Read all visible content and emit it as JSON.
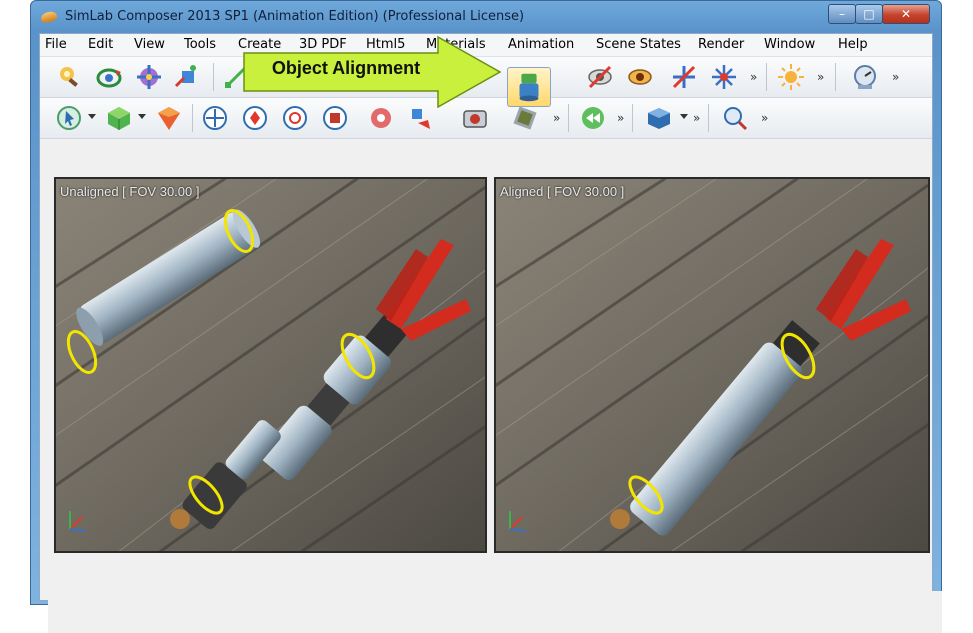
{
  "window": {
    "title": "SimLab Composer 2013 SP1 (Animation Edition)  (Professional License)",
    "controls": {
      "minimize": "–",
      "maximize": "□",
      "close": "✕"
    }
  },
  "menu": [
    "File",
    "Edit",
    "View",
    "Tools",
    "Create",
    "3D PDF",
    "Html5",
    "Materials",
    "Animation",
    "Scene States",
    "Render",
    "Window",
    "Help"
  ],
  "toolbar_overflow": "»",
  "callout": {
    "label": "Object Alignment",
    "color": "#c8f03c"
  },
  "viewports": {
    "left": {
      "label": "Unaligned [ FOV 30.00 ]"
    },
    "right": {
      "label": "Aligned [ FOV 30.00 ]"
    }
  },
  "colors": {
    "highlight_ring": "#f2e600",
    "handle_red": "#d42b1f",
    "tube": "#9fb3c2"
  }
}
